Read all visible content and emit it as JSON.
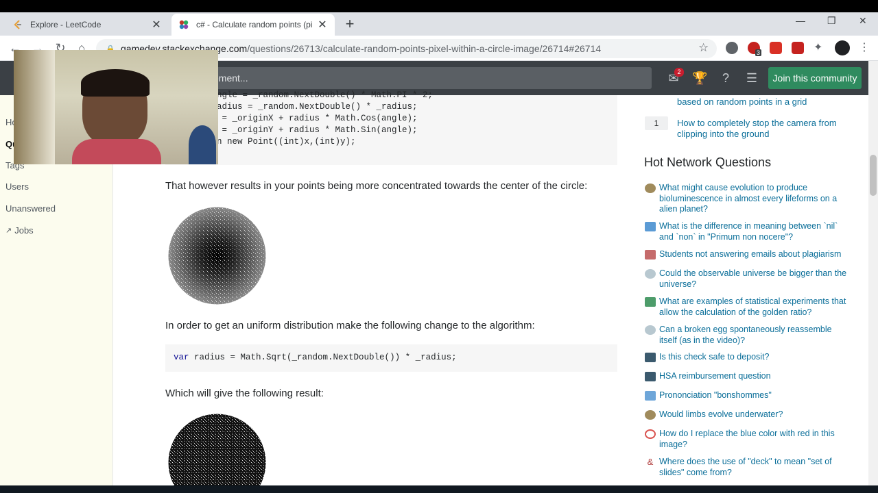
{
  "browser": {
    "tabs": [
      {
        "title": "Explore - LeetCode",
        "active": false
      },
      {
        "title": "c# - Calculate random points (pi",
        "active": true
      }
    ],
    "url_host": "gamedev.stackexchange.com",
    "url_path": "/questions/26713/calculate-random-points-pixel-within-a-circle-image/26714#26714",
    "ext_badge": "3"
  },
  "header": {
    "search_placeholder": "ement...",
    "inbox_badge": "2",
    "join_label": "Join this community"
  },
  "leftnav": {
    "items": [
      {
        "label": "Ho"
      },
      {
        "label": "Qu"
      },
      {
        "label": "Tags"
      },
      {
        "label": "Users"
      },
      {
        "label": "Unanswered"
      },
      {
        "label": "Jobs"
      }
    ]
  },
  "answer": {
    "code_lines_1": [
      "ngle = _random.NextDouble() * Math.PI * 2;",
      "adius = _random.NextDouble() * _radius;",
      " = _originX + radius * Math.Cos(angle);",
      " = _originY + radius * Math.Sin(angle);",
      "n new Point((int)x,(int)y);"
    ],
    "para1": "That however results in your points being more concentrated towards the center of the circle:",
    "para2": "In order to get an uniform distribution make the following change to the algorithm:",
    "code2_kw": "var",
    "code2_rest": " radius = Math.Sqrt(_random.NextDouble()) * _radius;",
    "para3": "Which will give the following result:"
  },
  "sidebar": {
    "linked": [
      {
        "count": "",
        "title": "based on random points in a grid"
      },
      {
        "count": "1",
        "title": "How to completely stop the camera from clipping into the ground"
      }
    ],
    "hnq_title": "Hot Network Questions",
    "hnq": [
      {
        "q": "What might cause evolution to produce bioluminescence in almost every lifeforms on a alien planet?",
        "icon_color": "#a08b5c"
      },
      {
        "q": "What is the difference in meaning between `nil` and `non` in \"Primum non nocere\"?",
        "icon_color": "#5b9bd5"
      },
      {
        "q": "Students not answering emails about plagiarism",
        "icon_color": "#c56b6b"
      },
      {
        "q": "Could the observable universe be bigger than the universe?",
        "icon_color": "#b8c8d0"
      },
      {
        "q": "What are examples of statistical experiments that allow the calculation of the golden ratio?",
        "icon_color": "#4d9c6a"
      },
      {
        "q": "Can a broken egg spontaneously reassemble itself (as in the video)?",
        "icon_color": "#b8c8d0"
      },
      {
        "q": "Is this check safe to deposit?",
        "icon_color": "#3b5a6e"
      },
      {
        "q": "HSA reimbursement question",
        "icon_color": "#3b5a6e"
      },
      {
        "q": "Prononciation \"bonshommes\"",
        "icon_color": "#6ea6d9"
      },
      {
        "q": "Would limbs evolve underwater?",
        "icon_color": "#a08b5c"
      },
      {
        "q": "How do I replace the blue color with red in this image?",
        "icon_color": "#d9534f"
      },
      {
        "q": "Where does the use of \"deck\" to mean \"set of slides\" come from?",
        "icon_color": "#b03a3a"
      }
    ]
  }
}
